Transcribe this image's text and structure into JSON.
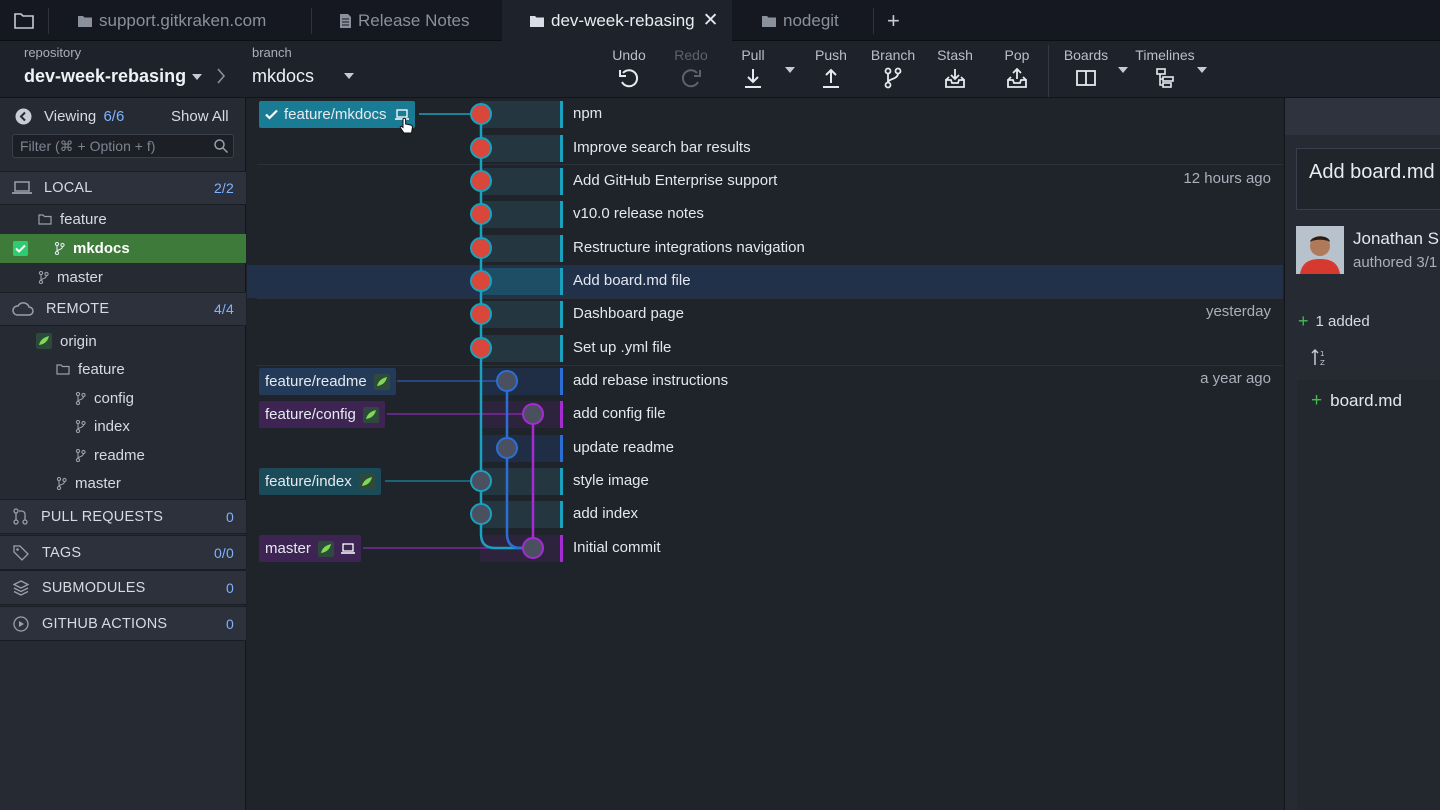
{
  "tabs": [
    {
      "label": "support.gitkraken.com",
      "icon": "folder-icon"
    },
    {
      "label": "Release Notes",
      "icon": "document-icon"
    },
    {
      "label": "dev-week-rebasing",
      "icon": "folder-icon",
      "active": true
    },
    {
      "label": "nodegit",
      "icon": "folder-icon"
    }
  ],
  "toolbar": {
    "repo_label": "repository",
    "repo_name": "dev-week-rebasing",
    "branch_label": "branch",
    "branch_name": "mkdocs",
    "undo": "Undo",
    "redo": "Redo",
    "pull": "Pull",
    "push": "Push",
    "branch": "Branch",
    "stash": "Stash",
    "pop": "Pop",
    "boards": "Boards",
    "timelines": "Timelines"
  },
  "sidebar": {
    "viewing_label": "Viewing",
    "viewing_count": "6/6",
    "show_all": "Show All",
    "filter_placeholder": "Filter (⌘ + Option + f)",
    "local": {
      "label": "LOCAL",
      "count": "2/2"
    },
    "local_items": {
      "folder": "feature",
      "branch_active": "mkdocs",
      "branch_master": "master"
    },
    "remote": {
      "label": "REMOTE",
      "count": "4/4"
    },
    "remote_items": {
      "origin": "origin",
      "folder": "feature",
      "config": "config",
      "index": "index",
      "readme": "readme",
      "master": "master"
    },
    "pull_requests": {
      "label": "PULL REQUESTS",
      "count": "0"
    },
    "tags": {
      "label": "TAGS",
      "count": "0/0"
    },
    "submodules": {
      "label": "SUBMODULES",
      "count": "0"
    },
    "actions": {
      "label": "GITHUB ACTIONS",
      "count": "0"
    }
  },
  "graph": {
    "branch_labels": {
      "mkdocs": "feature/mkdocs",
      "readme": "feature/readme",
      "config": "feature/config",
      "index": "feature/index",
      "master": "master"
    },
    "commits": [
      {
        "message": "npm",
        "time": ""
      },
      {
        "message": "Improve search bar results",
        "time": ""
      },
      {
        "message": "Add GitHub Enterprise support",
        "time": "12 hours ago"
      },
      {
        "message": "v10.0 release notes",
        "time": ""
      },
      {
        "message": "Restructure integrations navigation",
        "time": ""
      },
      {
        "message": "Add board.md file",
        "time": ""
      },
      {
        "message": "Dashboard page",
        "time": "yesterday"
      },
      {
        "message": "Set up .yml file",
        "time": ""
      },
      {
        "message": "add rebase instructions",
        "time": "a year ago"
      },
      {
        "message": "add config file",
        "time": ""
      },
      {
        "message": "update readme",
        "time": ""
      },
      {
        "message": "style image",
        "time": ""
      },
      {
        "message": "add index",
        "time": ""
      },
      {
        "message": "Initial commit",
        "time": ""
      }
    ]
  },
  "right_panel": {
    "title": "Add board.md",
    "author": "Jonathan Si",
    "authored": "authored 3/1",
    "added": "1 added",
    "file": "board.md"
  },
  "colors": {
    "accent_cyan": "#1aa1bf",
    "accent_blue": "#2b6fd6",
    "accent_purple": "#a52bd3",
    "local_active_green": "#3e7a3a"
  }
}
